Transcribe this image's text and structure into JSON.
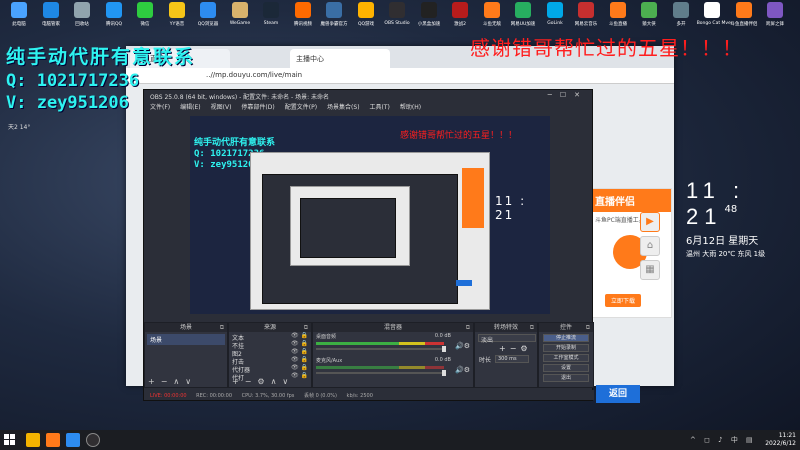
{
  "desktop": {
    "icons": [
      {
        "label": "此电脑",
        "color": "#4aa3ff"
      },
      {
        "label": "电脑管家",
        "color": "#1e88e5"
      },
      {
        "label": "回收站",
        "color": "#90a4ae"
      },
      {
        "label": "腾讯QQ",
        "color": "#2196f3"
      },
      {
        "label": "微信",
        "color": "#2ecc40"
      },
      {
        "label": "YY语音",
        "color": "#f5c518"
      },
      {
        "label": "QQ浏览器",
        "color": "#2d8cf0"
      },
      {
        "label": "WeGame",
        "color": "#d9b36c"
      },
      {
        "label": "Steam",
        "color": "#1b2838"
      },
      {
        "label": "腾讯视频",
        "color": "#ff6a00"
      },
      {
        "label": "魔兽争霸官方",
        "color": "#3a6ea5"
      },
      {
        "label": "QQ游戏",
        "color": "#ffb300"
      },
      {
        "label": "OBS Studio",
        "color": "#302e31"
      },
      {
        "label": "小黑盒加速",
        "color": "#222"
      },
      {
        "label": "激战2",
        "color": "#b71c1c"
      },
      {
        "label": "斗鱼无敌",
        "color": "#ff7a1a"
      },
      {
        "label": "网易UU加速",
        "color": "#27ae60"
      },
      {
        "label": "GoLink",
        "color": "#00a8e8"
      },
      {
        "label": "网易云音乐",
        "color": "#c62f2f"
      },
      {
        "label": "斗鱼直播",
        "color": "#ff7a1a"
      },
      {
        "label": "猿大侠",
        "color": "#4caf50"
      },
      {
        "label": "多开",
        "color": "#607d8b"
      },
      {
        "label": "Bongo Cat Mver",
        "color": "#fff"
      },
      {
        "label": "斗鱼直播伴侣",
        "color": "#ff7a1a"
      },
      {
        "label": "跨屏之锋",
        "color": "#7e57c2"
      }
    ],
    "weather_mini": "天2  14°",
    "clock": {
      "time": "11 : 21",
      "sec": "48",
      "date": "6月12日 星期天",
      "weather": "温州 大雨 20℃ 东风 1级"
    }
  },
  "overlays": {
    "contact_title": "纯手动代肝有意联系",
    "contact_qq": "Q: 1021717236",
    "contact_v": "V: zey951206",
    "thanks": "感谢错哥帮忙过的五星！！！"
  },
  "browser": {
    "tab1": "斗鱼直播",
    "tab2": "主播中心",
    "url": "..//mp.douyu.com/live/main",
    "banner_title": "直播伴侣",
    "banner_sub": "斗鱼PC端直播工具",
    "banner_dl": "立即下载",
    "return_label": "返回"
  },
  "obs": {
    "title": "OBS 25.0.8 (64 bit, windows) - 配置文件: 未命名 - 场景: 未命名",
    "menu": [
      "文件(F)",
      "编辑(E)",
      "视图(V)",
      "停靠部件(D)",
      "配置文件(P)",
      "场景集合(S)",
      "工具(T)",
      "帮助(H)"
    ],
    "docks": {
      "scenes": "场景",
      "sources": "来源",
      "mixer": "混音器",
      "transitions": "转场特效",
      "controls": "控件"
    },
    "scene_items": [
      "场景"
    ],
    "source_items": [
      "文本",
      "不挂",
      "图2",
      "打击",
      "代打器",
      "代打"
    ],
    "mixer": [
      {
        "name": "桌面音频",
        "db": "0.0 dB"
      },
      {
        "name": "麦克风/Aux",
        "db": "0.0 dB"
      }
    ],
    "transition_type": "淡出",
    "duration_label": "时长",
    "duration_value": "300 ms",
    "controls": [
      "停止推流",
      "开始录制",
      "工作室模式",
      "设置",
      "退出"
    ],
    "status": {
      "live": "LIVE: 00:00:00",
      "rec": "REC: 00:00:00",
      "cpu": "CPU: 3.7%, 30.00 fps",
      "drop": "丢帧 0 (0.0%)",
      "kbps": "kb/s: 2500"
    },
    "preview": {
      "contact_title": "纯手动代肝有意联系",
      "contact_qq": "Q: 1021717236",
      "contact_v": "V: zey951206",
      "thanks": "感谢错哥帮忙过的五星！！！",
      "clock": "11 : 21"
    }
  },
  "taskbar": {
    "time": "11:21",
    "date": "2022/6/12",
    "tray": "^ ◻ ♪ 中 ▤"
  }
}
